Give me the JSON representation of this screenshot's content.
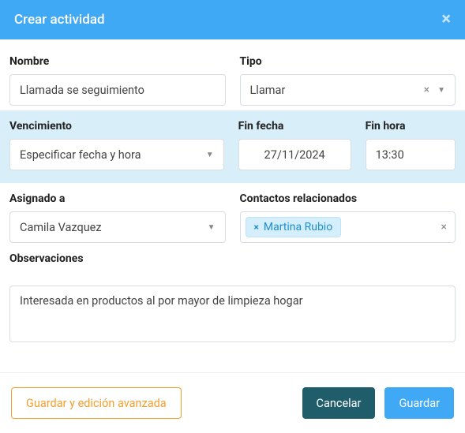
{
  "header": {
    "title": "Crear actividad"
  },
  "fields": {
    "name_label": "Nombre",
    "name_value": "Llamada se seguimiento",
    "type_label": "Tipo",
    "type_value": "Llamar",
    "due_label": "Vencimiento",
    "due_value": "Especificar fecha y hora",
    "end_date_label": "Fin fecha",
    "end_date_value": "27/11/2024",
    "end_time_label": "Fin hora",
    "end_time_value": "13:30",
    "assigned_label": "Asignado a",
    "assigned_value": "Camila Vazquez",
    "contacts_label": "Contactos relacionados",
    "contact_chip": "Martina Rubio",
    "notes_label": "Observaciones",
    "notes_value": "Interesada en productos al por mayor de limpieza hogar"
  },
  "buttons": {
    "advanced": "Guardar y edición avanzada",
    "cancel": "Cancelar",
    "save": "Guardar"
  },
  "glyphs": {
    "close": "×",
    "clear": "×",
    "caret": "▼",
    "chip_x": "×"
  }
}
